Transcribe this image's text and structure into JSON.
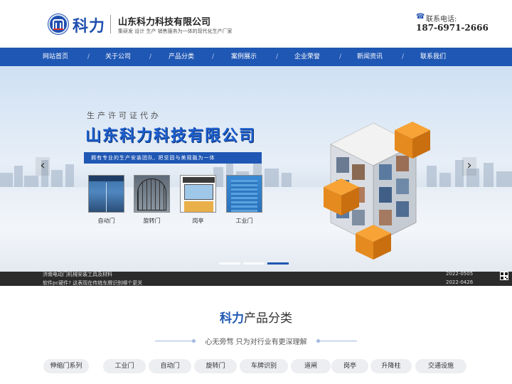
{
  "header": {
    "logo_text": "科力",
    "company_name": "山东科力科技有限公司",
    "slogan": "集研发 设计 生产 销售服务为一体的现代化生产厂家",
    "phone_label": "联系电话:",
    "phone_number": "187-6971-2666"
  },
  "nav": {
    "items": [
      "网站首页",
      "关于公司",
      "产品分类",
      "案例展示",
      "企业荣誉",
      "新闻资讯",
      "联系我们"
    ],
    "separator": "/"
  },
  "banner": {
    "subtitle": "生产许可证代办",
    "title": "山东科力科技有限公司",
    "ribbon": "拥有专业的生产安装团队, 把坚固与美观融为一体",
    "products": [
      "自动门",
      "旋转门",
      "岗亭",
      "工业门"
    ],
    "prev_arrow": "‹",
    "next_arrow": "›",
    "slide_count": 3,
    "active_slide": 3
  },
  "ticker": {
    "items": [
      {
        "text": "济南电动门机械安装工具及材料",
        "date": "2022-0505"
      },
      {
        "text": "软件pc硬件? 这表现在传统车牌识别哪个更关",
        "date": "2022-0426"
      }
    ]
  },
  "products_section": {
    "title_accent": "科力",
    "title_rest": "产品分类",
    "subtitle": "心无旁骛 只为对行业有更深理解",
    "categories": [
      "伸缩门系列",
      "工业门",
      "自动门",
      "旋转门",
      "车牌识别",
      "道闸",
      "岗亭",
      "升降柱",
      "交通设施"
    ]
  },
  "colors": {
    "brand_blue": "#1f57b4",
    "ticker_bg": "#2b2b2b",
    "category_bg": "#eceef1"
  }
}
